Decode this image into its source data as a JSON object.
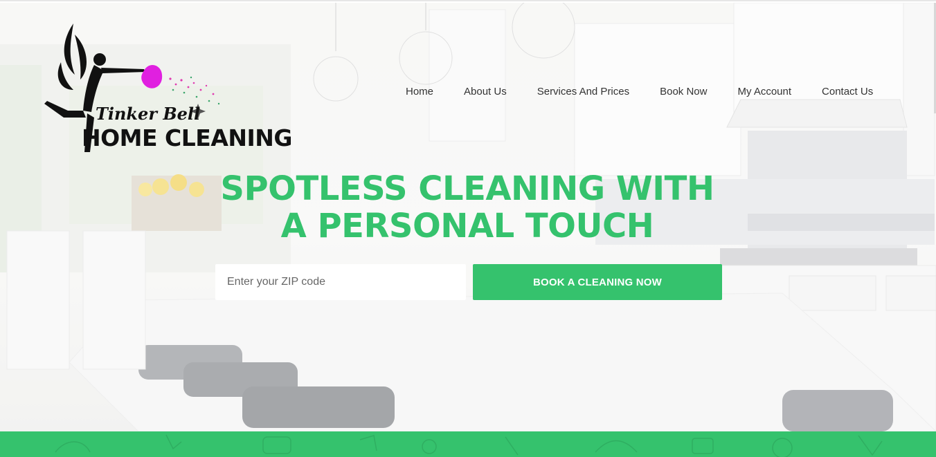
{
  "logo": {
    "line1": "Tinker Bell",
    "line2": "HOME CLEANING"
  },
  "nav": {
    "items": [
      {
        "label": "Home"
      },
      {
        "label": "About Us"
      },
      {
        "label": "Services And Prices"
      },
      {
        "label": "Book Now"
      },
      {
        "label": "My Account"
      },
      {
        "label": "Contact Us"
      }
    ]
  },
  "hero": {
    "headline_line1": "SPOTLESS CLEANING WITH",
    "headline_line2": "A PERSONAL TOUCH",
    "zip_placeholder": "Enter your ZIP code",
    "zip_value": "",
    "book_button": "BOOK A CLEANING NOW"
  },
  "colors": {
    "accent": "#35c26d",
    "logo_duster": "#e020e0",
    "logo_text": "#111111"
  },
  "icons": {
    "logo_figure": "fairy-silhouette-icon",
    "duster": "feather-duster-icon"
  }
}
